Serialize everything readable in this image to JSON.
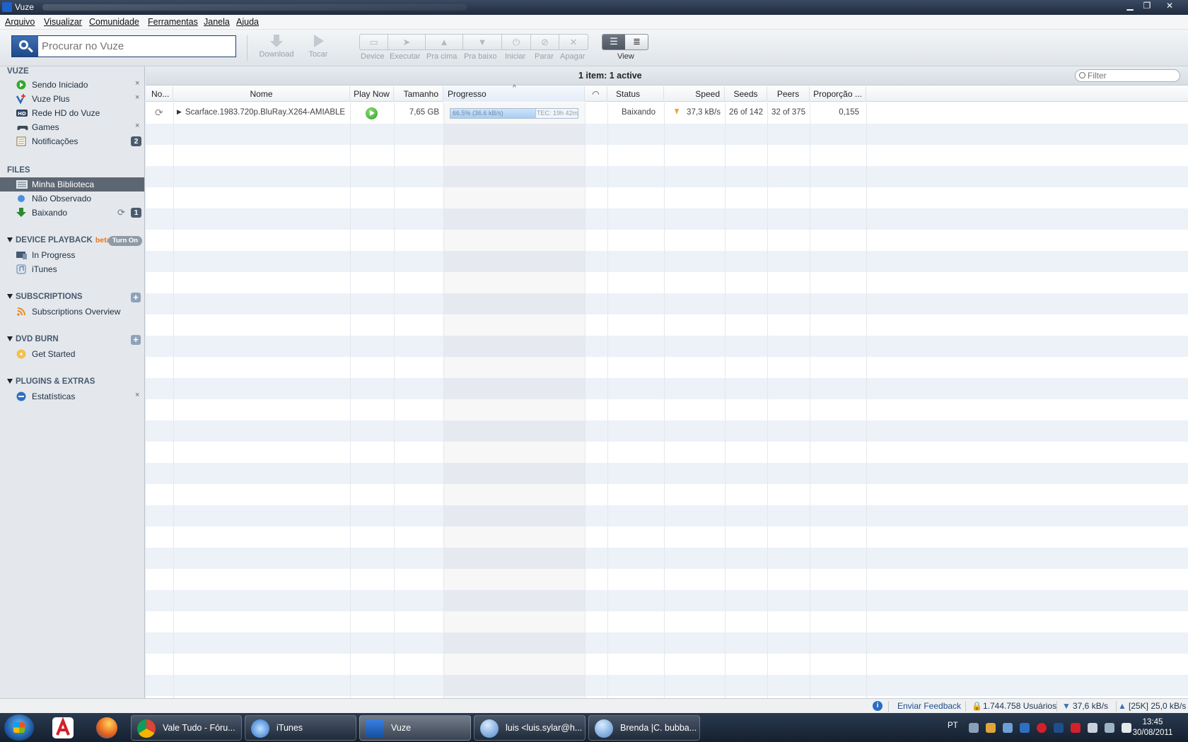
{
  "window": {
    "title": "Vuze",
    "controls": {
      "minimize": "▁",
      "maximize": "❐",
      "close": "✕"
    }
  },
  "menu": [
    "Arquivo",
    "Visualizar",
    "Comunidade",
    "Ferramentas",
    "Janela",
    "Ajuda"
  ],
  "toolbar": {
    "search_placeholder": "Procurar no Vuze",
    "download": "Download",
    "play": "Tocar",
    "actions": [
      "Device",
      "Executar",
      "Pra cima",
      "Pra baixo",
      "Iniciar",
      "Parar",
      "Apagar"
    ],
    "view": "View"
  },
  "sidebar": {
    "vuze_header": "VUZE",
    "vuze_items": [
      {
        "label": "Sendo Iniciado",
        "close": "×"
      },
      {
        "label": "Vuze Plus",
        "close": "×"
      },
      {
        "label": "Rede HD do Vuze"
      },
      {
        "label": "Games",
        "close": "×"
      },
      {
        "label": "Notificações",
        "badge": "2"
      }
    ],
    "files_header": "FILES",
    "files_items": [
      {
        "label": "Minha Biblioteca"
      },
      {
        "label": "Não Observado"
      },
      {
        "label": "Baixando",
        "badge": "1"
      }
    ],
    "device_header": "DEVICE PLAYBACK",
    "device_beta": "beta",
    "device_turn_on": "Turn On",
    "device_items": [
      {
        "label": "In Progress"
      },
      {
        "label": "iTunes"
      }
    ],
    "subs_header": "SUBSCRIPTIONS",
    "subs_items": [
      {
        "label": "Subscriptions Overview"
      }
    ],
    "dvd_header": "DVD BURN",
    "dvd_items": [
      {
        "label": "Get Started"
      }
    ],
    "plugins_header": "PLUGINS & EXTRAS",
    "plugins_items": [
      {
        "label": "Estatísticas",
        "close": "×"
      }
    ]
  },
  "main": {
    "item_count": "1 item: 1 active",
    "filter_placeholder": "Filter",
    "columns": [
      "No...",
      "Nome",
      "Play Now",
      "Tamanho",
      "Progresso",
      "",
      "Status",
      "Speed",
      "Seeds",
      "Peers",
      "Proporção ..."
    ],
    "rows": [
      {
        "name": "Scarface.1983.720p.BluRay.X264-AMIABLE",
        "size": "7,65 GB",
        "progress_text": "66.5% (36.6 kB/s)",
        "progress_fraction": 0.665,
        "eta": "TEC: 19h 42m",
        "status": "Baixando",
        "speed": "37,3 kB/s",
        "seeds": "26 of 142",
        "peers": "32 of 375",
        "ratio": "0,155"
      }
    ]
  },
  "statusbar": {
    "feedback": "Enviar Feedback",
    "users": "1.744.758 Usuários",
    "down": "37,6 kB/s",
    "up": "[25K] 25,0 kB/s"
  },
  "taskbar": {
    "tasks": [
      "Vale Tudo - Fóru...",
      "iTunes",
      "Vuze",
      "luis <luis.sylar@h...",
      "Brenda  |C. bubba..."
    ],
    "lang": "PT",
    "time": "13:45",
    "date": "30/08/2011"
  }
}
